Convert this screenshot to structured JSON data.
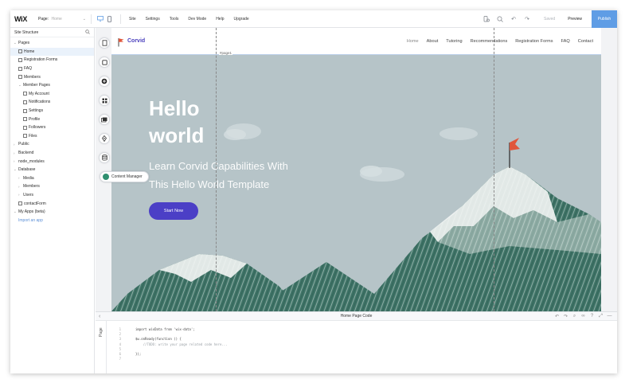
{
  "topbar": {
    "logo": "WiX",
    "page_label": "Page:",
    "page_value": "Home",
    "menu": [
      "Site",
      "Settings",
      "Tools",
      "Dev Mode",
      "Help",
      "Upgrade"
    ],
    "saved": "Saved",
    "preview": "Preview",
    "publish": "Publish"
  },
  "sidebar": {
    "title": "Site Structure",
    "tree": [
      {
        "label": "Pages",
        "level": 0,
        "type": "caret-open"
      },
      {
        "label": "Home",
        "level": 1,
        "type": "page",
        "active": true
      },
      {
        "label": "Registration Forms",
        "level": 1,
        "type": "page"
      },
      {
        "label": "FAQ",
        "level": 1,
        "type": "page"
      },
      {
        "label": "Members",
        "level": 1,
        "type": "page"
      },
      {
        "label": "Member Pages",
        "level": 1,
        "type": "caret-open"
      },
      {
        "label": "My Account",
        "level": 2,
        "type": "page"
      },
      {
        "label": "Notifications",
        "level": 2,
        "type": "page"
      },
      {
        "label": "Settings",
        "level": 2,
        "type": "page"
      },
      {
        "label": "Profile",
        "level": 2,
        "type": "page"
      },
      {
        "label": "Followers",
        "level": 2,
        "type": "page"
      },
      {
        "label": "Files",
        "level": 2,
        "type": "page"
      },
      {
        "label": "Public",
        "level": 0,
        "type": "caret"
      },
      {
        "label": "Backend",
        "level": 0,
        "type": "caret"
      },
      {
        "label": "node_modules",
        "level": 0,
        "type": "caret"
      },
      {
        "label": "Database",
        "level": 0,
        "type": "caret-open"
      },
      {
        "label": "Media",
        "level": 1,
        "type": "caret"
      },
      {
        "label": "Members",
        "level": 1,
        "type": "caret"
      },
      {
        "label": "Users",
        "level": 1,
        "type": "caret"
      },
      {
        "label": "contactForm",
        "level": 1,
        "type": "page"
      },
      {
        "label": "My Apps (beta)",
        "level": 0,
        "type": "caret-open"
      },
      {
        "label": "Import an app",
        "level": 1,
        "type": "link"
      }
    ]
  },
  "site": {
    "brand": "Corvid",
    "nav": [
      "Home",
      "About",
      "Tutoring",
      "Recommendations",
      "Registration Forms",
      "FAQ",
      "Contact"
    ],
    "page_tag": "#page1",
    "hero_title_1": "Hello",
    "hero_title_2": "world",
    "hero_sub_1": "Learn Corvid Capabilities With",
    "hero_sub_2": "This Hello World Template",
    "cta": "Start Now",
    "colors": {
      "sky": "#b6c4c8",
      "brand": "#4b3fc6",
      "mountain": "#3f7467",
      "flag": "#e0563b"
    }
  },
  "rail": {
    "items": [
      "pages-icon",
      "add-icon",
      "apps-icon",
      "media-icon",
      "blog-icon",
      "database-icon"
    ],
    "tooltip": "Content Manager"
  },
  "code_panel": {
    "title": "Home Page Code",
    "tab": "Page",
    "line_numbers": [
      "1",
      "2",
      "3",
      "4",
      "5",
      "6",
      "7"
    ],
    "lines": [
      "import wixData from 'wix-data';",
      "",
      "$w.onReady(function () {",
      "    //TODO: write your page related code here...",
      "",
      "});",
      ""
    ]
  }
}
